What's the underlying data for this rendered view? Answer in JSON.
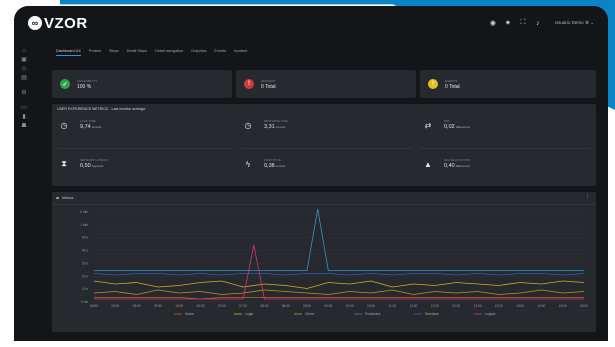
{
  "app": {
    "logo_text": "VZOR"
  },
  "topbar": {
    "user_label": "Usuario Demo"
  },
  "tabs": [
    {
      "label": "Dashboard UX",
      "active": true
    },
    {
      "label": "Probes"
    },
    {
      "label": "Steps"
    },
    {
      "label": "Detail Steps"
    },
    {
      "label": "Detail navigation"
    },
    {
      "label": "Graphics"
    },
    {
      "label": "Events"
    },
    {
      "label": "Incident"
    }
  ],
  "kpis": [
    {
      "label": "AVAILABILITY",
      "value": "100 %",
      "color": "#2fa44f",
      "icon": "check-icon"
    },
    {
      "label": "INCIDENT",
      "value": "0 Total",
      "color": "#d23a3a",
      "icon": "exclamation-icon"
    },
    {
      "label": "EVENTS",
      "value": "0 Total",
      "color": "#e3c21f",
      "icon": "exclamation-icon"
    }
  ],
  "metrics": {
    "title": "USER EXPERIENCE METRICS - Last monitor average",
    "items": [
      {
        "label": "LOAD TIME",
        "value": "9,74",
        "unit": "seconds",
        "icon": "clock-icon"
      },
      {
        "label": "RESPONSE TIME",
        "value": "3,31",
        "unit": "seconds",
        "icon": "clock-icon"
      },
      {
        "label": "DNS",
        "value": "0,02",
        "unit": "Milliseconds",
        "icon": "transfer-arrows-icon"
      },
      {
        "label": "NETWORK LATENCY",
        "value": "0,50",
        "unit": "Segundos",
        "icon": "hourglass-icon"
      },
      {
        "label": "FIRST BYTE",
        "value": "0,38",
        "unit": "seconds",
        "icon": "lightning-icon"
      },
      {
        "label": "SSL NEGOTIATION",
        "value": "0,40",
        "unit": "Milliseconds",
        "icon": "lock-icon"
      }
    ]
  },
  "chart_data": {
    "type": "line",
    "title": "Infoxxx",
    "y_ticks": [
      "5 min",
      "1 min",
      "50 s",
      "40 s",
      "30 s",
      "20 s",
      "10 s",
      "0 ms"
    ],
    "x_ticks": [
      "08:00",
      "08:30",
      "09:00",
      "09:30",
      "10:00",
      "06:30",
      "07:00",
      "07:30",
      "08:00",
      "08:30",
      "09:00",
      "09:30",
      "10:00",
      "10:30",
      "11:00",
      "11:30",
      "12:00",
      "12:30",
      "13:00",
      "13:30",
      "14:00",
      "14:30",
      "15:00",
      "15:30"
    ],
    "ylim": [
      0,
      60
    ],
    "series": [
      {
        "name": "Home",
        "color": "#d35a2a",
        "values": [
          3,
          3,
          3,
          3,
          3,
          2,
          3,
          3,
          3,
          3,
          3,
          3,
          3,
          3,
          3,
          3,
          3,
          3,
          3,
          3,
          3,
          3,
          3,
          3
        ]
      },
      {
        "name": "Login",
        "color": "#c9b422",
        "values": [
          14,
          12,
          13,
          10,
          11,
          13,
          14,
          10,
          12,
          11,
          9,
          13,
          12,
          14,
          10,
          12,
          11,
          13,
          12,
          11,
          13,
          12,
          14,
          13
        ]
      },
      {
        "name": "Cierre",
        "color": "#b39a24",
        "values": [
          6,
          7,
          5,
          8,
          6,
          7,
          5,
          6,
          8,
          7,
          6,
          5,
          7,
          6,
          8,
          5,
          7,
          6,
          7,
          5,
          6,
          8,
          6,
          7
        ]
      },
      {
        "name": "Productos",
        "color": "#3b8fd0",
        "values": [
          21,
          21,
          21,
          21,
          21,
          21,
          21,
          21,
          21,
          21,
          21,
          21,
          21,
          21,
          21,
          21,
          21,
          21,
          21,
          21,
          21,
          21,
          21,
          21
        ]
      },
      {
        "name": "Servicios",
        "color": "#2f5fb3",
        "values": [
          19,
          18,
          19,
          19,
          18,
          19,
          18,
          19,
          19,
          18,
          19,
          19,
          18,
          19,
          18,
          19,
          19,
          18,
          19,
          18,
          19,
          19,
          18,
          19
        ]
      },
      {
        "name": "Logout",
        "color": "#d2357c",
        "values": [
          2,
          2,
          2,
          2,
          2,
          2,
          2,
          2,
          2,
          2,
          2,
          2,
          2,
          2,
          2,
          2,
          2,
          2,
          2,
          2,
          2,
          2,
          2,
          2
        ]
      }
    ],
    "spikes": [
      {
        "series": "Logout",
        "between_index": 7,
        "value": 38
      },
      {
        "series": "Productos",
        "between_index": 10,
        "value": 62
      }
    ],
    "legend_position": "bottom"
  }
}
